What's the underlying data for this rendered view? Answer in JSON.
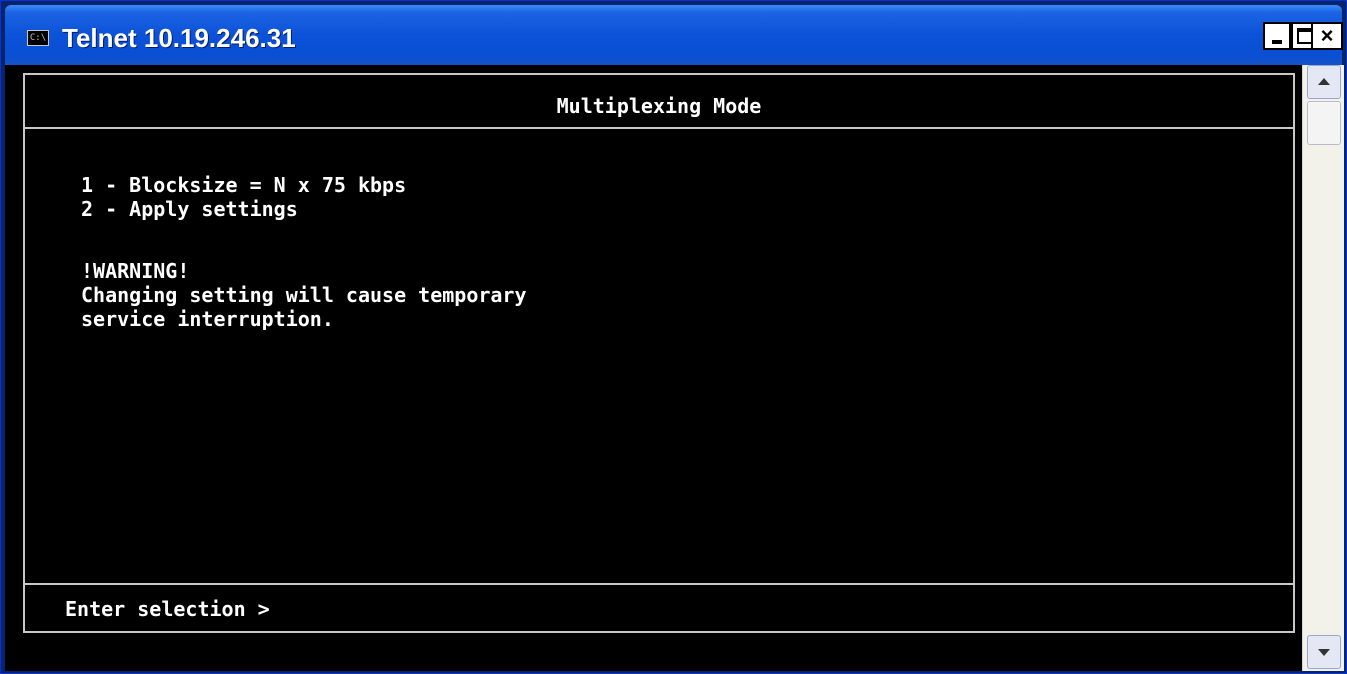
{
  "window": {
    "title": "Telnet 10.19.246.31",
    "icon": "console-icon",
    "icon_text": "C:\\",
    "controls": {
      "minimize": "minimize-icon",
      "maximize": "maximize-icon",
      "close": "close-icon",
      "close_glyph": "×"
    }
  },
  "terminal": {
    "header": "Multiplexing Mode",
    "menu_items": [
      "1 - Blocksize = N x 75 kbps",
      "2 - Apply settings"
    ],
    "warning": {
      "title": "!WARNING!",
      "lines": [
        "Changing setting will cause temporary",
        "service interruption."
      ]
    },
    "prompt": "Enter selection >"
  },
  "scrollbar": {
    "up": "scroll-up-arrow-icon",
    "down": "scroll-down-arrow-icon"
  },
  "colors": {
    "titlebar": "#0b52d8",
    "terminal_bg": "#000000",
    "terminal_fg": "#ffffff",
    "frame": "#c8c8c8"
  }
}
